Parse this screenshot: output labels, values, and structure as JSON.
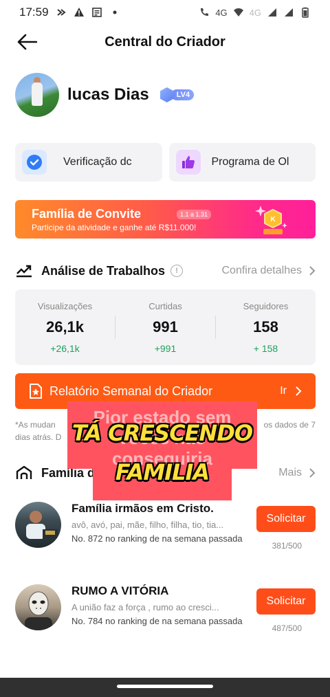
{
  "status_bar": {
    "time": "17:59",
    "network_a": "4G",
    "network_b": "4G"
  },
  "header": {
    "title": "Central do Criador"
  },
  "profile": {
    "name": "lucas Dias",
    "level": "LV4"
  },
  "quick_cards": [
    {
      "label": "Verificação dc",
      "icon": "check-badge-icon"
    },
    {
      "label": "Programa de Ol",
      "icon": "thumbs-up-icon"
    }
  ],
  "banner": {
    "title": "Família de Convite",
    "date": "1.1 a 1.31",
    "subtitle": "Participe da atividade e ganhe até R$11.000!"
  },
  "analysis": {
    "title": "Análise de Trabalhos",
    "link": "Confira detalhes",
    "stats": [
      {
        "label": "Visualizações",
        "value": "26,1k",
        "delta": "+26,1k"
      },
      {
        "label": "Curtidas",
        "value": "991",
        "delta": "+991"
      },
      {
        "label": "Seguidores",
        "value": "158",
        "delta": "+ 158"
      }
    ]
  },
  "report": {
    "title": "Relatório Semanal do Criador",
    "cta": "Ir"
  },
  "note": {
    "left": "*As mudan",
    "right": "os dados de 7",
    "line2_left": "dias atrás. D"
  },
  "family": {
    "title": "Família d",
    "link": "Mais",
    "groups": [
      {
        "name": "Família irmãos em Cristo.",
        "desc": "avô, avó, pai, mãe, filho, filha, tio, tia...",
        "rank": "No. 872 no ranking de na semana passada",
        "button": "Solicitar",
        "count": "381/500"
      },
      {
        "name": "RUMO A VITÓRIA",
        "desc": "A união faz a força , rumo ao cresci...",
        "rank": "No. 784 no ranking de na semana passada",
        "button": "Solicitar",
        "count": "487/500"
      }
    ]
  },
  "overlay": {
    "ghost_text": "Pior estado sem vocês não conseguiria",
    "caption_line1": "TÁ CRESCENDO",
    "caption_line2": "FAMILIA"
  }
}
